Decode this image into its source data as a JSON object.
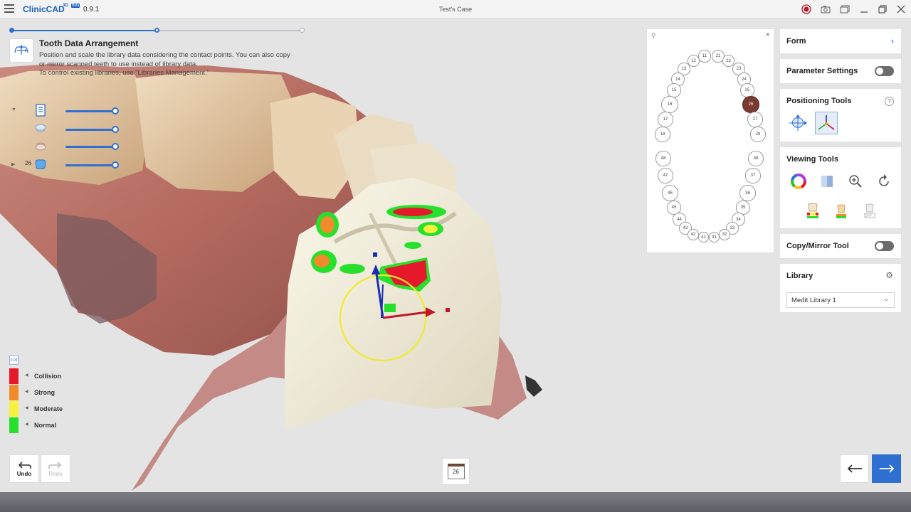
{
  "app": {
    "brand": "ClinicCAD",
    "brand_badge": "3D",
    "brand_badge2": "Beta",
    "version": "0.9.1",
    "window_title": "Test's Case"
  },
  "step": {
    "title": "Tooth Data Arrangement",
    "description": "Position and scale the library data considering the contact points. You can also copy or mirror scanned teeth to use instead of library data.",
    "description2": "To control existing libraries, use \"Libraries Management.\"",
    "progress_steps": 3,
    "current_step": 2
  },
  "sliders": [
    {
      "name": "scan-document",
      "value": 1.0
    },
    {
      "name": "upper-jaw",
      "value": 1.0
    },
    {
      "name": "lower-jaw",
      "value": 1.0
    },
    {
      "name": "tooth-26",
      "label": "26",
      "value": 1.0
    }
  ],
  "legend": {
    "header_icon": "0.00",
    "items": [
      {
        "label": "Collision",
        "color": "#e5182c"
      },
      {
        "label": "Strong",
        "color": "#f18a2a"
      },
      {
        "label": "Moderate",
        "color": "#f7f03c"
      },
      {
        "label": "Normal",
        "color": "#27e02b"
      }
    ]
  },
  "tooth_chart": {
    "upper": [
      "11",
      "21",
      "12",
      "22",
      "13",
      "23",
      "14",
      "24",
      "15",
      "25",
      "16",
      "26",
      "17",
      "27",
      "18",
      "28"
    ],
    "lower": [
      "48",
      "38",
      "47",
      "37",
      "46",
      "36",
      "45",
      "35",
      "44",
      "34",
      "43",
      "33",
      "42",
      "32",
      "41",
      "31"
    ],
    "selected": "26"
  },
  "right_panel": {
    "form": "Form",
    "parameter_settings": "Parameter Settings",
    "positioning_tools": "Positioning Tools",
    "help": "?",
    "viewing_tools": "Viewing Tools",
    "copy_mirror": "Copy/Mirror Tool",
    "library": "Library",
    "library_selected": "Medit Library 1",
    "view_badge": "OFF"
  },
  "bottom": {
    "undo": "Undo",
    "redo": "Redo",
    "tooth_number": "26"
  },
  "colors": {
    "accent": "#2f6fd1",
    "selected_tooth": "#7a3a30"
  }
}
